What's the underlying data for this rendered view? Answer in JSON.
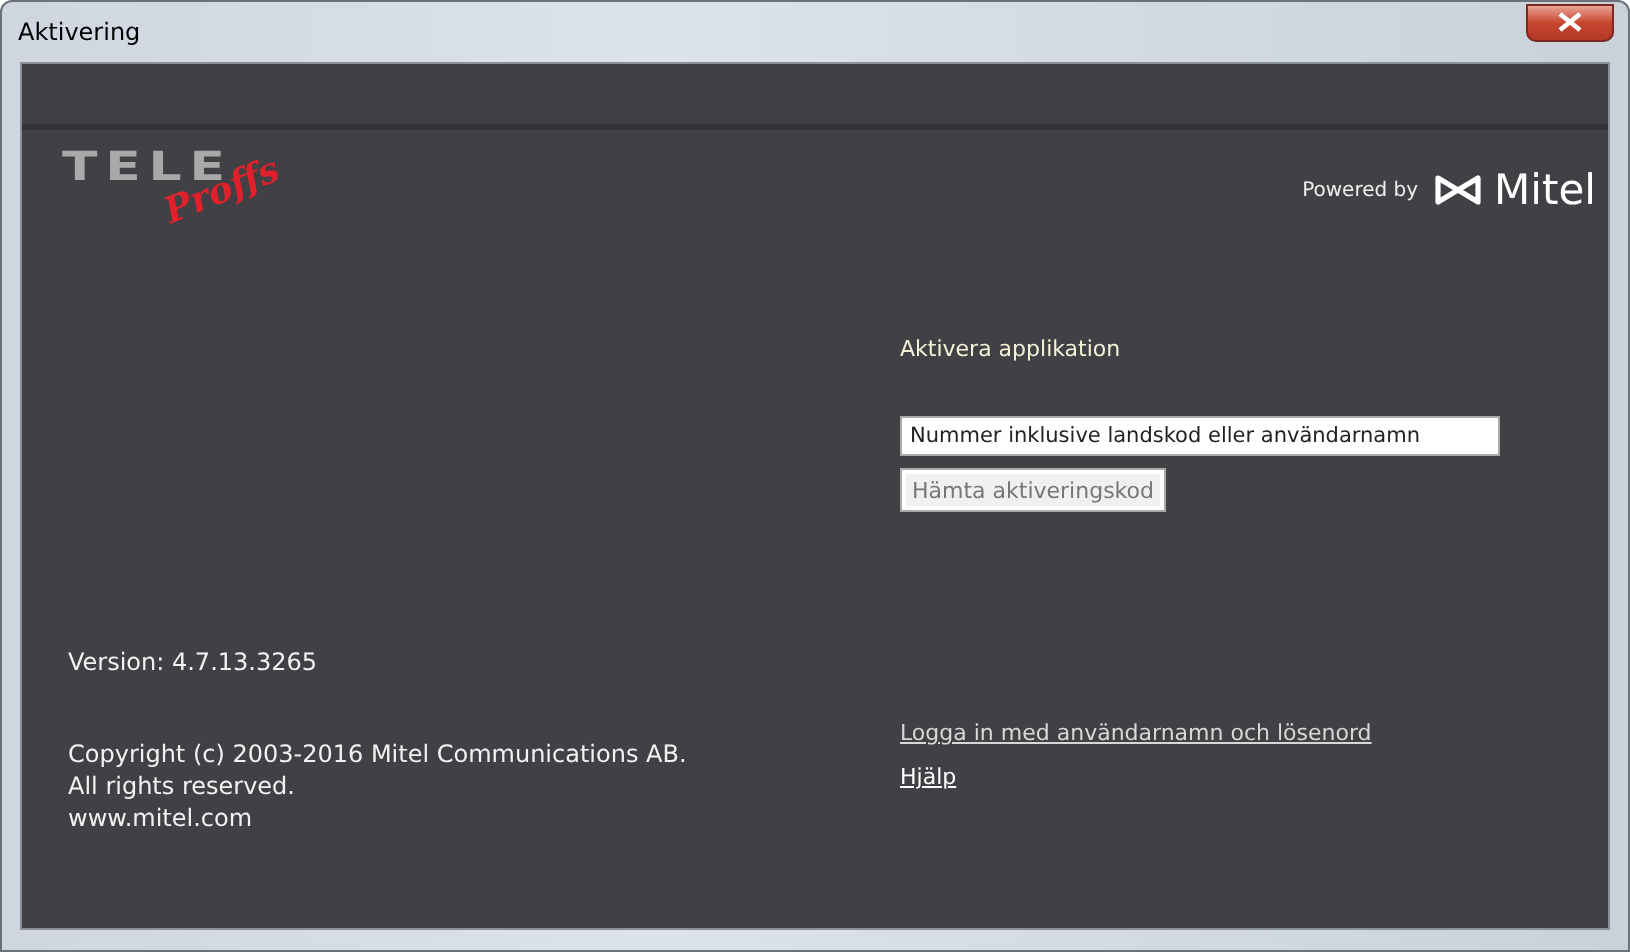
{
  "window": {
    "title": "Aktivering"
  },
  "logo": {
    "top": "TELE",
    "script": "Proffs"
  },
  "powered": {
    "label": "Powered by",
    "brand": "Mitel"
  },
  "activation": {
    "heading": "Aktivera applikation",
    "field": {
      "placeholder": "Nummer inklusive landskod eller användarnamn"
    },
    "button": {
      "label": "Hämta aktiveringskod",
      "disabled": true
    }
  },
  "version": "Version: 4.7.13.3265",
  "copyright": [
    "Copyright (c) 2003-2016 Mitel Communications AB.",
    "All rights reserved.",
    "www.mitel.com"
  ],
  "links": [
    "Logga in med användarnamn och lösenord",
    "Hjälp"
  ]
}
